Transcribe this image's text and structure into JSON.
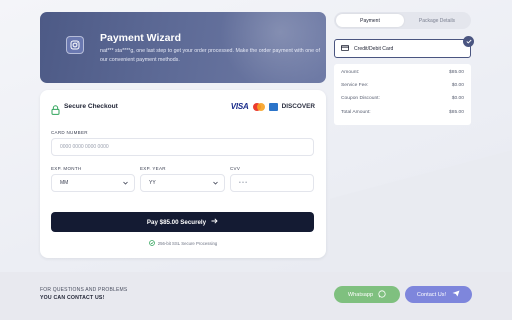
{
  "hero": {
    "title": "Payment Wizard",
    "subtitle": "nat*** sta****g, one last step to get your order processed. Make the order payment with one of our convenient payment methods."
  },
  "checkout": {
    "title": "Secure Checkout",
    "brands": {
      "visa": "VISA",
      "discover": "DISCOVER"
    },
    "card_number_label": "CARD NUMBER",
    "card_number_placeholder": "0000 0000 0000 0000",
    "exp_month_label": "EXP. MONTH",
    "exp_month_value": "MM",
    "exp_year_label": "EXP. YEAR",
    "exp_year_value": "YY",
    "cvv_label": "CVV",
    "cvv_placeholder": "• • •",
    "pay_button": "Pay $85.00 Securely",
    "ssl_note": "256-bit SSL Secure Processing"
  },
  "tabs": {
    "payment": "Payment",
    "package": "Package Details"
  },
  "method": {
    "label": "Credit/Debit Card"
  },
  "summary": {
    "rows": [
      {
        "label": "Amount:",
        "value": "$85.00"
      },
      {
        "label": "Service Fee:",
        "value": "$0.00"
      },
      {
        "label": "Coupon Discount:",
        "value": "$0.00"
      },
      {
        "label": "Total Amount:",
        "value": "$85.00"
      }
    ]
  },
  "footer": {
    "line1": "FOR QUESTIONS AND PROBLEMS",
    "line2": "YOU CAN CONTACT US!",
    "whatsapp": "Whatsapp",
    "contact": "Contact Us!"
  },
  "colors": {
    "hero": "#5d6a96",
    "pay_button": "#141b33",
    "whatsapp": "#7fc07f",
    "contact": "#7e86dc",
    "selected_border": "#4a5580"
  }
}
